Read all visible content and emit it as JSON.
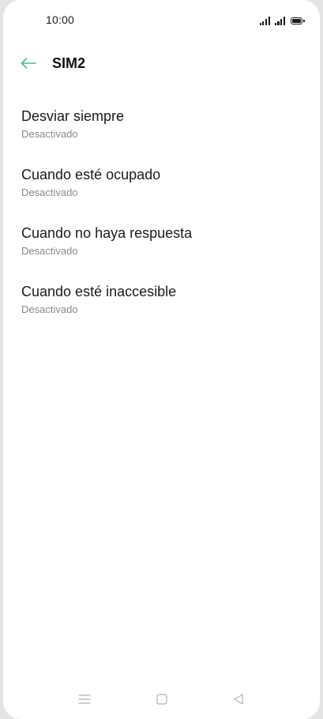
{
  "status_bar": {
    "time": "10:00",
    "icons": [
      "signal-sim1-icon",
      "signal-sim2-icon",
      "battery-icon"
    ]
  },
  "app_bar": {
    "back_icon": "arrow-left-icon",
    "title": "SIM2"
  },
  "accent_color": "#3cc189",
  "options": [
    {
      "title": "Desviar siempre",
      "status": "Desactivado"
    },
    {
      "title": "Cuando esté ocupado",
      "status": "Desactivado"
    },
    {
      "title": "Cuando no haya respuesta",
      "status": "Desactivado"
    },
    {
      "title": "Cuando esté inaccesible",
      "status": "Desactivado"
    }
  ],
  "nav_bar": {
    "icons": [
      "menu-icon",
      "home-icon",
      "back-icon"
    ]
  }
}
